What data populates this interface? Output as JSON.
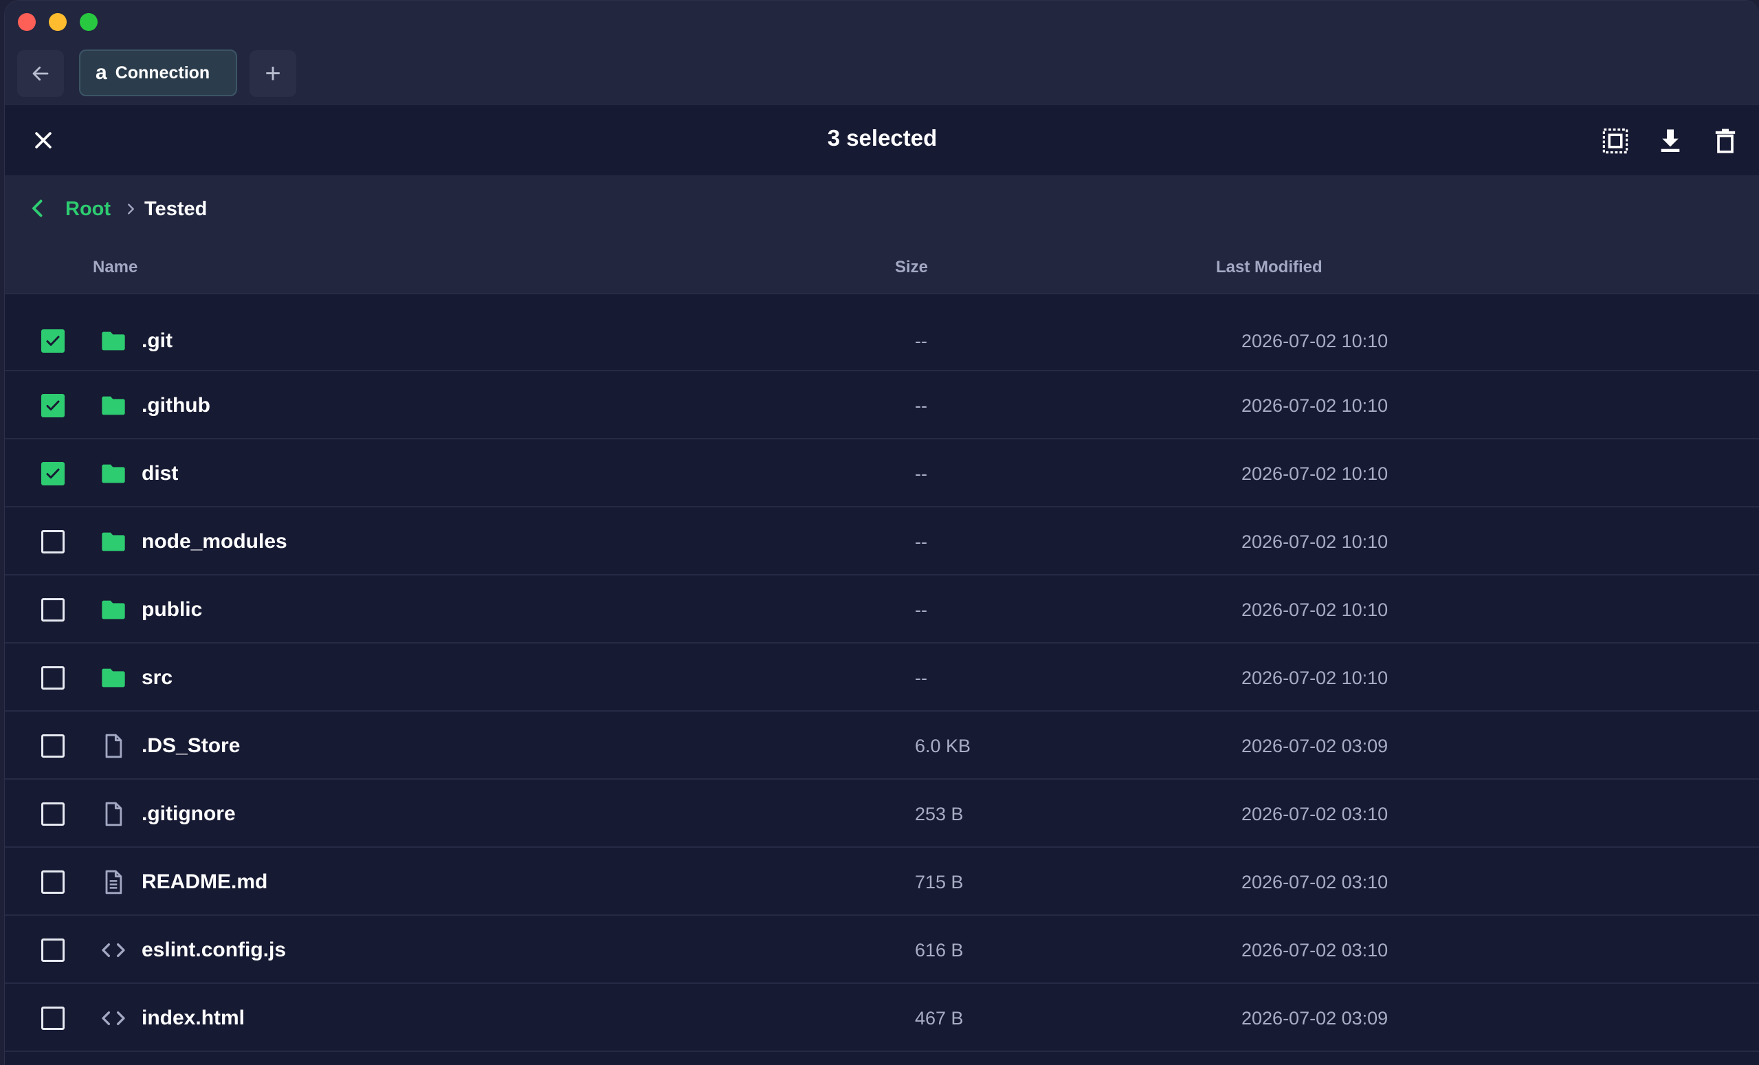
{
  "tabs": {
    "connection_label": "Connection",
    "connection_glyph": "a",
    "add_label": "+"
  },
  "selection": {
    "title": "3 selected"
  },
  "breadcrumb": {
    "root": "Root",
    "current": "Tested"
  },
  "columns": {
    "name": "Name",
    "size": "Size",
    "modified": "Last Modified"
  },
  "files": [
    {
      "name": ".git",
      "size": "--",
      "modified": "2026-07-02 10:10",
      "kind": "folder",
      "checked": true
    },
    {
      "name": ".github",
      "size": "--",
      "modified": "2026-07-02 10:10",
      "kind": "folder",
      "checked": true
    },
    {
      "name": "dist",
      "size": "--",
      "modified": "2026-07-02 10:10",
      "kind": "folder",
      "checked": true
    },
    {
      "name": "node_modules",
      "size": "--",
      "modified": "2026-07-02 10:10",
      "kind": "folder",
      "checked": false
    },
    {
      "name": "public",
      "size": "--",
      "modified": "2026-07-02 10:10",
      "kind": "folder",
      "checked": false
    },
    {
      "name": "src",
      "size": "--",
      "modified": "2026-07-02 10:10",
      "kind": "folder",
      "checked": false
    },
    {
      "name": ".DS_Store",
      "size": "6.0 KB",
      "modified": "2026-07-02 03:09",
      "kind": "file",
      "checked": false
    },
    {
      "name": ".gitignore",
      "size": "253 B",
      "modified": "2026-07-02 03:10",
      "kind": "file",
      "checked": false
    },
    {
      "name": "README.md",
      "size": "715 B",
      "modified": "2026-07-02 03:10",
      "kind": "text",
      "checked": false
    },
    {
      "name": "eslint.config.js",
      "size": "616 B",
      "modified": "2026-07-02 03:10",
      "kind": "code",
      "checked": false
    },
    {
      "name": "index.html",
      "size": "467 B",
      "modified": "2026-07-02 03:09",
      "kind": "code",
      "checked": false
    }
  ],
  "colors": {
    "accent": "#2ecc71",
    "background": "#171a33",
    "panel": "#22263f"
  }
}
